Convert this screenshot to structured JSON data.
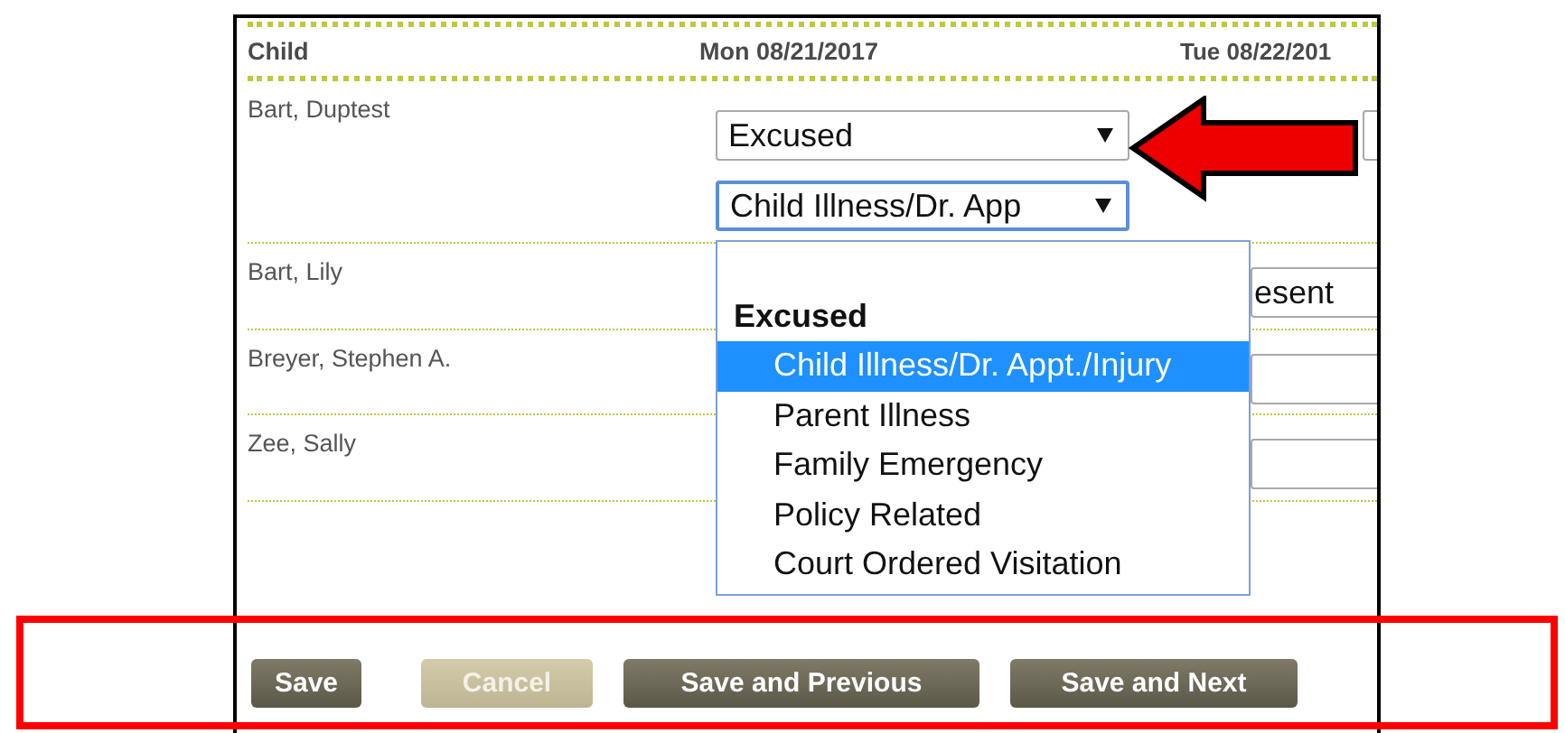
{
  "table": {
    "columns": [
      "Child",
      "Mon 08/21/2017",
      "Tue 08/22/201"
    ],
    "rows": [
      {
        "child": "Bart, Duptest",
        "status": "Excused",
        "reason": {
          "value": "Child Illness/Dr. App",
          "focused": true
        }
      },
      {
        "child": "Bart, Lily",
        "tue": "esent"
      },
      {
        "child": "Breyer, Stephen A."
      },
      {
        "child": "Zee, Sally"
      }
    ]
  },
  "dropdown": {
    "options": [
      {
        "kind": "blank"
      },
      {
        "kind": "group",
        "label": "Excused"
      },
      {
        "kind": "option",
        "label": "Child Illness/Dr. Appt./Injury",
        "selected": true
      },
      {
        "kind": "option",
        "label": "Parent Illness",
        "selected": false
      },
      {
        "kind": "option",
        "label": "Family Emergency",
        "selected": false
      },
      {
        "kind": "option",
        "label": "Policy Related",
        "selected": false
      },
      {
        "kind": "option",
        "label": "Court Ordered Visitation",
        "selected": false
      }
    ]
  },
  "buttons": [
    {
      "label": "Save",
      "disabled": false
    },
    {
      "label": "Cancel",
      "disabled": true
    },
    {
      "label": "Save and Previous",
      "disabled": false
    },
    {
      "label": "Save and Next",
      "disabled": false
    }
  ]
}
